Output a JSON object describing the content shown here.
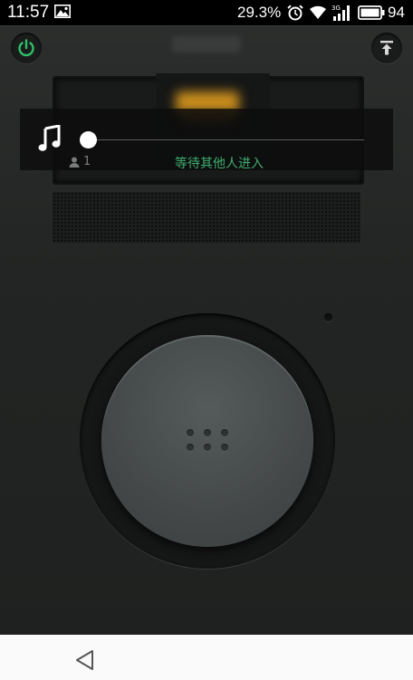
{
  "status_bar": {
    "time": "11:57",
    "battery_percent": "29.3%",
    "battery_level": "94",
    "icons": [
      "picture-icon",
      "alarm-icon",
      "wifi-icon",
      "signal-3g-icon",
      "battery-icon"
    ]
  },
  "toolbar": {
    "power_icon": "power-icon",
    "upload_icon": "upload-icon",
    "accent_color": "#2fbf6a"
  },
  "player": {
    "music_icon": "music-note-icon",
    "user_count": "1",
    "waiting_text": "等待其他人进入",
    "waiting_text_color": "#3fae6f"
  },
  "navigation": {
    "back_icon": "back-triangle-icon"
  }
}
